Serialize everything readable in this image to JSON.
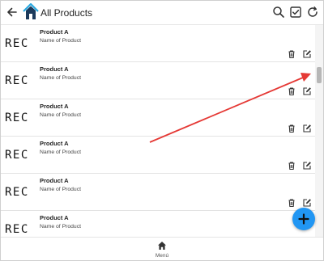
{
  "header": {
    "title": "All Products",
    "back_icon": "arrow-left-icon",
    "logo_icon": "house-logo-icon",
    "actions": [
      "search-icon",
      "checkbox-icon",
      "refresh-icon"
    ]
  },
  "products": [
    {
      "thumb": "REC",
      "title": "Product A",
      "subtitle": "Name of Product"
    },
    {
      "thumb": "REC",
      "title": "Product A",
      "subtitle": "Name of Product"
    },
    {
      "thumb": "REC",
      "title": "Product A",
      "subtitle": "Name of Product"
    },
    {
      "thumb": "REC",
      "title": "Product A",
      "subtitle": "Name of Product"
    },
    {
      "thumb": "REC",
      "title": "Product A",
      "subtitle": "Name of Product"
    },
    {
      "thumb": "REC",
      "title": "Product A",
      "subtitle": "Name of Product"
    }
  ],
  "row_actions": [
    "trash-icon",
    "edit-icon"
  ],
  "fab": {
    "icon": "plus-icon",
    "color": "#2196f3"
  },
  "bottom_nav": {
    "label": "Menú",
    "icon": "home-icon"
  },
  "annotation": {
    "color": "#e53935"
  }
}
